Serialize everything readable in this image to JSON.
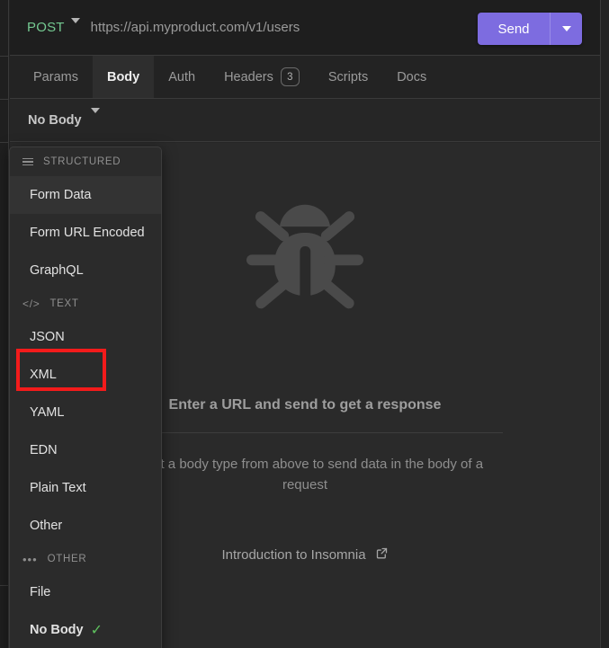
{
  "colors": {
    "accent": "#7d6ce0",
    "method": "#74c991",
    "annotation": "#f31b1b",
    "check": "#5ec15e",
    "panel_bg": "#2a2a2a",
    "menu_bg": "#2b2b2b"
  },
  "url_bar": {
    "method": "POST",
    "method_caret_icon": "chevron-down-icon",
    "url": "https://api.myproduct.com/v1/users",
    "send_label": "Send",
    "send_caret_icon": "chevron-down-icon"
  },
  "tabs": [
    {
      "label": "Params",
      "active": false,
      "badge": null
    },
    {
      "label": "Body",
      "active": true,
      "badge": null
    },
    {
      "label": "Auth",
      "active": false,
      "badge": null
    },
    {
      "label": "Headers",
      "active": false,
      "badge": "3"
    },
    {
      "label": "Scripts",
      "active": false,
      "badge": null
    },
    {
      "label": "Docs",
      "active": false,
      "badge": null
    }
  ],
  "body_type_selector": {
    "label": "No Body",
    "caret_icon": "chevron-down-icon"
  },
  "menu": {
    "sections": [
      {
        "header": "STRUCTURED",
        "icon": "hamburger-icon",
        "items": [
          {
            "label": "Form Data",
            "hovered": true,
            "checked": false,
            "bold": false
          },
          {
            "label": "Form URL Encoded",
            "hovered": false,
            "checked": false,
            "bold": false
          },
          {
            "label": "GraphQL",
            "hovered": false,
            "checked": false,
            "bold": false
          }
        ]
      },
      {
        "header": "TEXT",
        "icon": "code-icon",
        "items": [
          {
            "label": "JSON",
            "hovered": false,
            "checked": false,
            "bold": false
          },
          {
            "label": "XML",
            "hovered": false,
            "checked": false,
            "bold": false
          },
          {
            "label": "YAML",
            "hovered": false,
            "checked": false,
            "bold": false
          },
          {
            "label": "EDN",
            "hovered": false,
            "checked": false,
            "bold": false
          },
          {
            "label": "Plain Text",
            "hovered": false,
            "checked": false,
            "bold": false
          },
          {
            "label": "Other",
            "hovered": false,
            "checked": false,
            "bold": false
          }
        ]
      },
      {
        "header": "OTHER",
        "icon": "ellipsis-icon",
        "items": [
          {
            "label": "File",
            "hovered": false,
            "checked": false,
            "bold": false
          },
          {
            "label": "No Body",
            "hovered": false,
            "checked": true,
            "bold": true
          }
        ]
      }
    ],
    "check_glyph": "✓"
  },
  "empty_state": {
    "icon": "bug-icon",
    "title": "Enter a URL and send to get a response",
    "subtitle": "Select a body type from above to send data in the body of a request",
    "link_label": "Introduction to Insomnia",
    "link_icon": "external-link-icon"
  },
  "annotation": {
    "target_label": "XML",
    "shape": "rectangle"
  }
}
